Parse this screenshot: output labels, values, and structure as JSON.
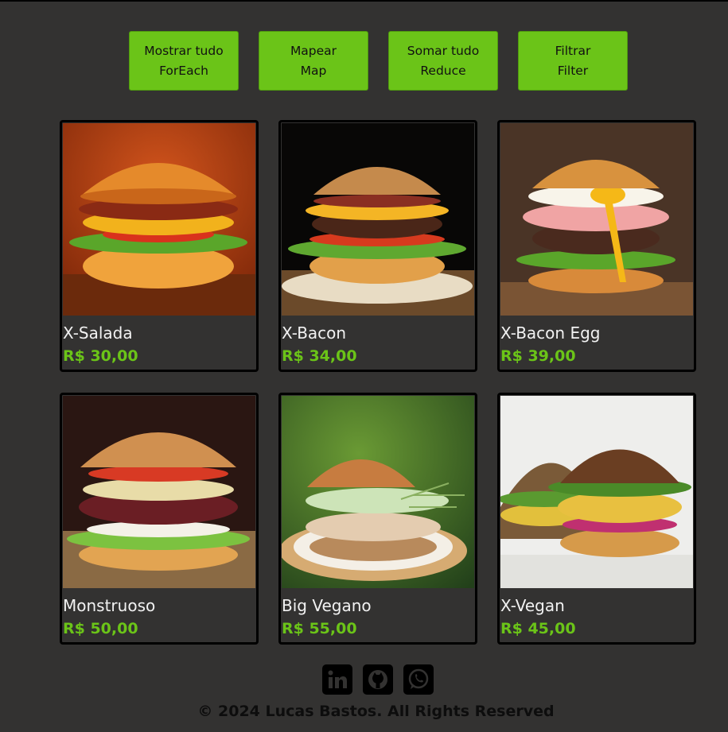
{
  "buttons": [
    {
      "line1": "Mostrar tudo",
      "line2": "ForEach"
    },
    {
      "line1": "Mapear",
      "line2": "Map"
    },
    {
      "line1": "Somar tudo",
      "line2": "Reduce"
    },
    {
      "line1": "Filtrar",
      "line2": "Filter"
    }
  ],
  "products": [
    {
      "name": "X-Salada",
      "price": "R$ 30,00"
    },
    {
      "name": "X-Bacon",
      "price": "R$ 34,00"
    },
    {
      "name": "X-Bacon Egg",
      "price": "R$ 39,00"
    },
    {
      "name": "Monstruoso",
      "price": "R$ 50,00"
    },
    {
      "name": "Big Vegano",
      "price": "R$ 55,00"
    },
    {
      "name": "X-Vegan",
      "price": "R$ 45,00"
    }
  ],
  "social": [
    "linkedin-icon",
    "github-icon",
    "whatsapp-icon"
  ],
  "footer": {
    "text": "© 2024 Lucas Bastos. All Rights Reserved"
  },
  "colors": {
    "accent": "#6bc418",
    "background": "#333231",
    "text": "#f2f2f2"
  }
}
